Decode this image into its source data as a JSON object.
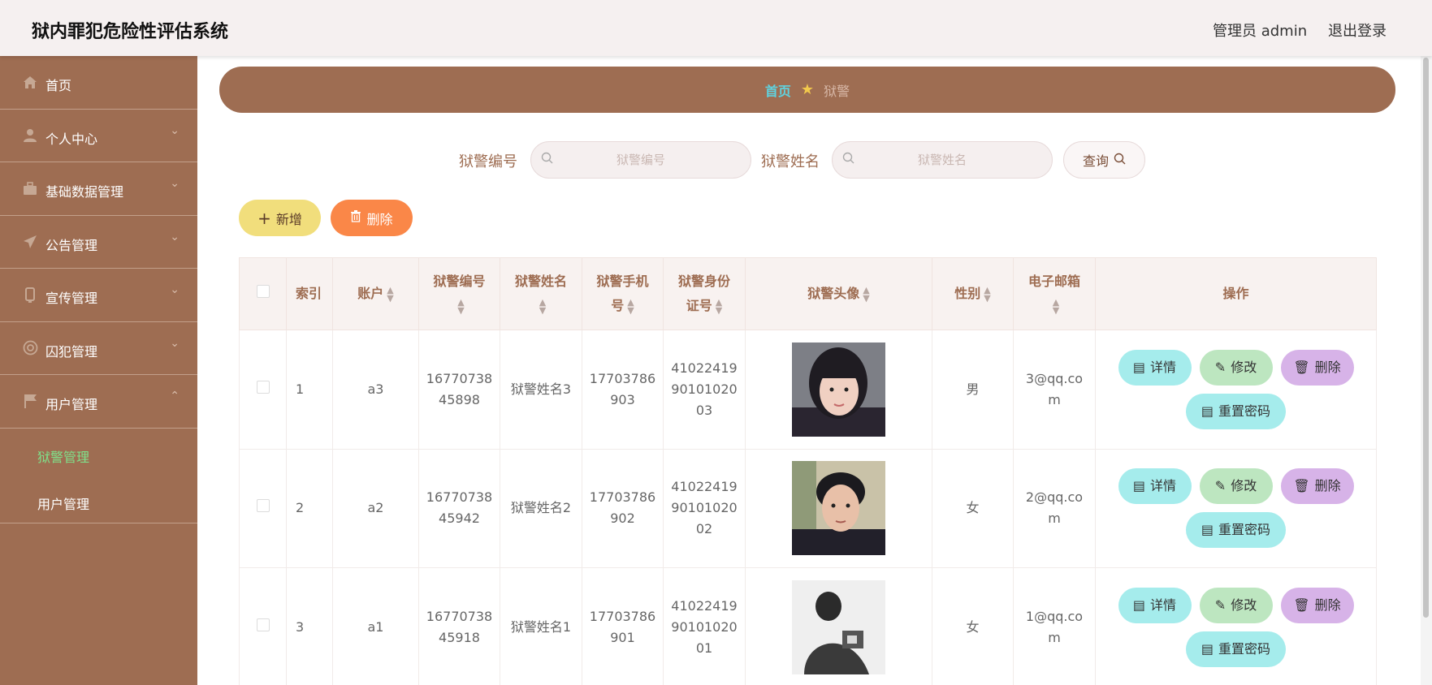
{
  "app": {
    "title": "狱内罪犯危险性评估系统",
    "admin": "管理员 admin",
    "logout": "退出登录"
  },
  "sidebar": {
    "items": [
      {
        "label": "首页",
        "icon": "home-icon"
      },
      {
        "label": "个人中心",
        "icon": "user-icon",
        "arrow": "⌄"
      },
      {
        "label": "基础数据管理",
        "icon": "briefcase-icon",
        "arrow": "⌄"
      },
      {
        "label": "公告管理",
        "icon": "send-icon",
        "arrow": "⌄"
      },
      {
        "label": "宣传管理",
        "icon": "device-icon",
        "arrow": "⌄"
      },
      {
        "label": "囚犯管理",
        "icon": "at-icon",
        "arrow": "⌄"
      },
      {
        "label": "用户管理",
        "icon": "flag-icon",
        "arrow": "⌃"
      }
    ],
    "subitems": [
      {
        "label": "狱警管理",
        "active": true
      },
      {
        "label": "用户管理",
        "active": false
      }
    ]
  },
  "breadcrumb": {
    "home": "首页",
    "current": "狱警"
  },
  "search": {
    "field1_label": "狱警编号",
    "field1_placeholder": "狱警编号",
    "field2_label": "狱警姓名",
    "field2_placeholder": "狱警姓名",
    "query_label": "查询"
  },
  "toolbar": {
    "add_label": "新增",
    "delete_label": "删除"
  },
  "table": {
    "headers": [
      "索引",
      "账户",
      "狱警编号",
      "狱警姓名",
      "狱警手机号",
      "狱警身份证号",
      "狱警头像",
      "性别",
      "电子邮箱",
      "操作"
    ],
    "header_lines": {
      "col2_1": "狱警编号",
      "col3_1": "狱警姓名",
      "col4_1": "狱警手机",
      "col4_2": "号",
      "col5_1": "狱警身份",
      "col5_2": "证号",
      "col7_1": "电子邮箱"
    },
    "rows": [
      {
        "index": "1",
        "account": "a3",
        "number_1": "16770738",
        "number_2": "45898",
        "name": "狱警姓名3",
        "phone_1": "17703786",
        "phone_2": "903",
        "id_1": "41022419",
        "id_2": "90101020",
        "id_3": "03",
        "gender": "男",
        "email_1": "3@qq.co",
        "email_2": "m"
      },
      {
        "index": "2",
        "account": "a2",
        "number_1": "16770738",
        "number_2": "45942",
        "name": "狱警姓名2",
        "phone_1": "17703786",
        "phone_2": "902",
        "id_1": "41022419",
        "id_2": "90101020",
        "id_3": "02",
        "gender": "女",
        "email_1": "2@qq.co",
        "email_2": "m"
      },
      {
        "index": "3",
        "account": "a1",
        "number_1": "16770738",
        "number_2": "45918",
        "name": "狱警姓名1",
        "phone_1": "17703786",
        "phone_2": "901",
        "id_1": "41022419",
        "id_2": "90101020",
        "id_3": "01",
        "gender": "女",
        "email_1": "1@qq.co",
        "email_2": "m"
      }
    ],
    "actions": {
      "detail": "详情",
      "edit": "修改",
      "delete": "删除",
      "reset": "重置密码"
    }
  }
}
